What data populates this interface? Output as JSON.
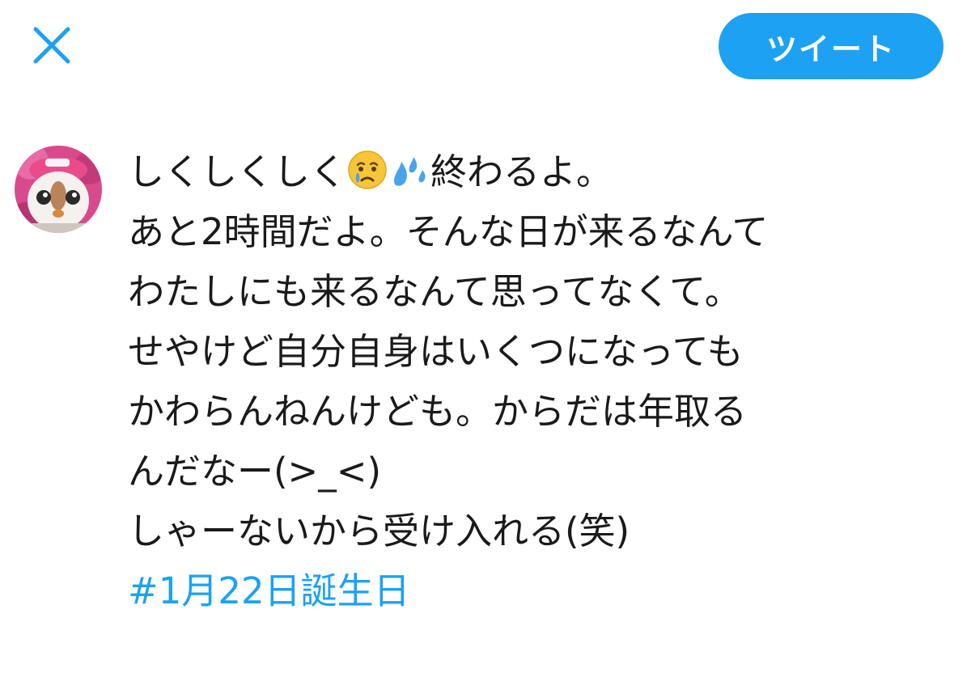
{
  "header": {
    "tweet_button_label": "ツイート",
    "close_icon": "close-icon"
  },
  "composer": {
    "avatar_icon": "avatar-plush-icon",
    "line1_before": "しくしくしく",
    "line1_after": "終わるよ。",
    "emoji_1": "crying-face-emoji",
    "emoji_2": "sweat-droplets-emoji",
    "lines": [
      "あと2時間だよ。そんな日が来るなんて",
      "わたしにも来るなんて思ってなくて。",
      "せやけど自分自身はいくつになっても",
      "かわらんねんけども。からだは年取る",
      "んだなー(>_<)",
      "しゃーないから受け入れる(笑)"
    ],
    "hashtag": "#1月22日誕生日"
  },
  "colors": {
    "accent": "#1da1f2",
    "text": "#1a1a1a"
  }
}
